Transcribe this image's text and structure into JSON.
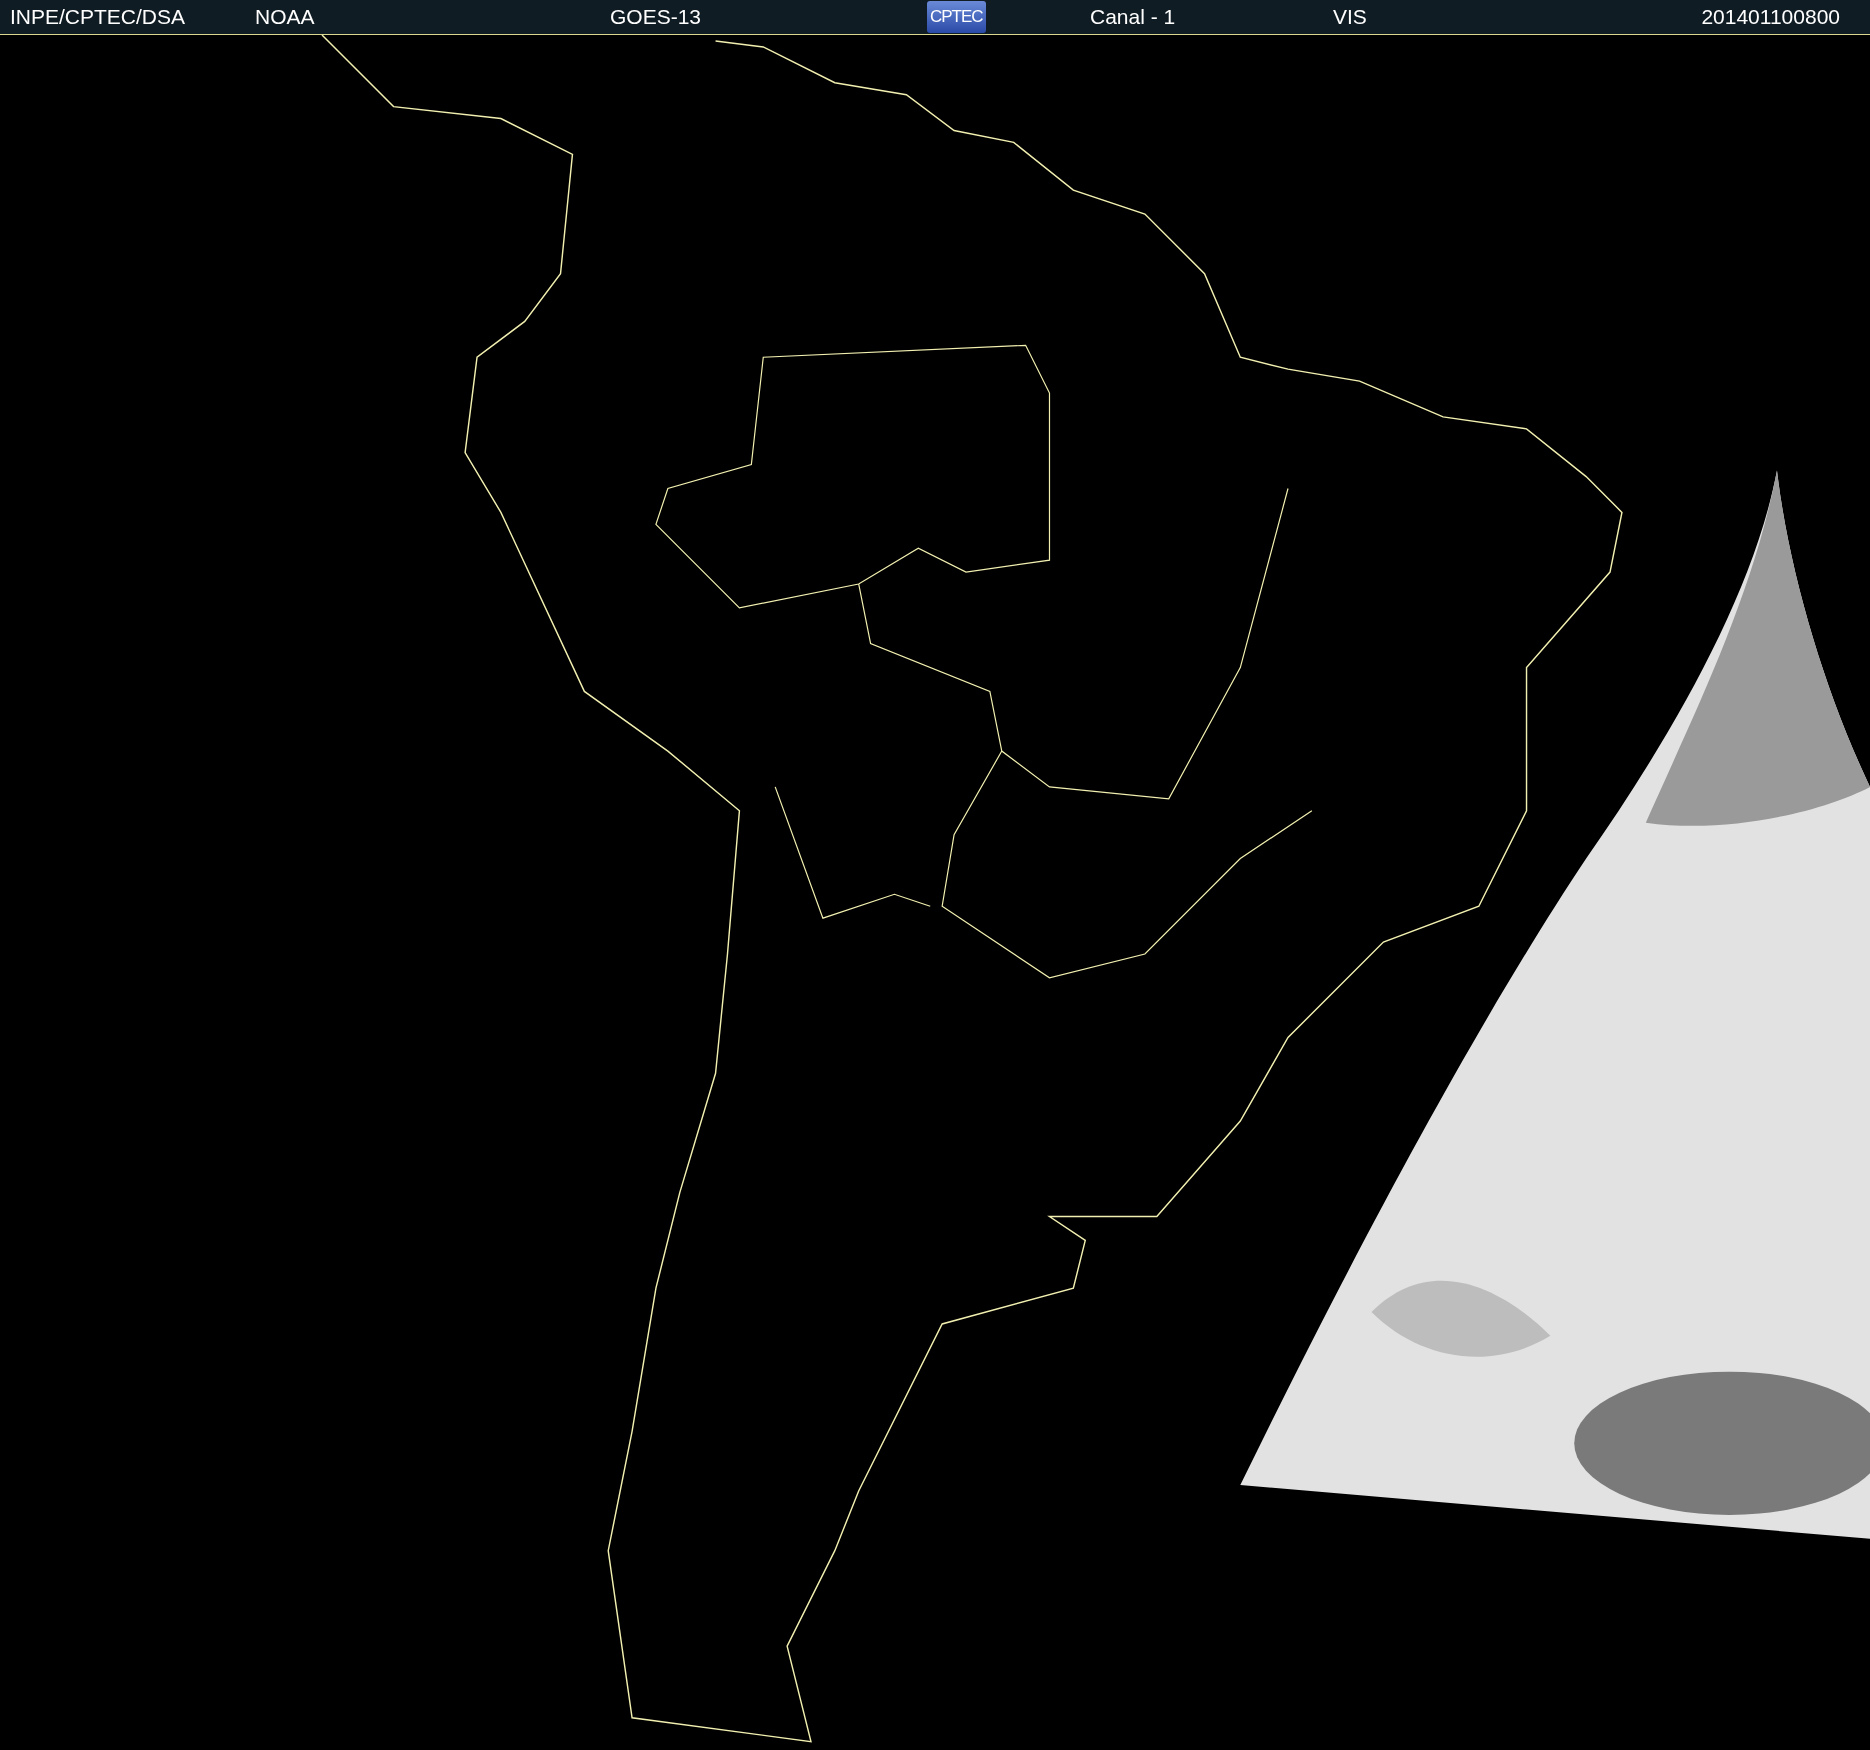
{
  "header": {
    "items": [
      {
        "kind": "text",
        "text": "INPE/CPTEC/DSA"
      },
      {
        "kind": "text",
        "text": "NOAA"
      },
      {
        "kind": "text",
        "text": "GOES-13"
      },
      {
        "kind": "logo",
        "text": "CPTEC"
      },
      {
        "kind": "text",
        "text": "Canal - 1"
      },
      {
        "kind": "text",
        "text": "VIS"
      },
      {
        "kind": "text",
        "text": "201401100800"
      }
    ]
  }
}
